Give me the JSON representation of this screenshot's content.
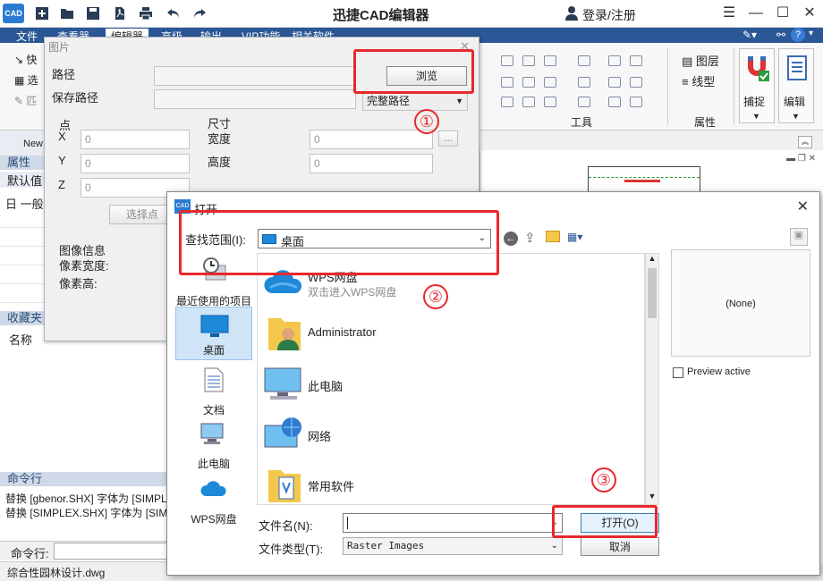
{
  "app": {
    "title": "迅捷CAD编辑器",
    "login": "登录/注册",
    "logo": "CAD"
  },
  "menu": {
    "tabs": [
      "文件",
      "查看器",
      "编辑器",
      "高级",
      "输出",
      "VIP功能",
      "相关软件"
    ]
  },
  "ribbon": {
    "left_labels": [
      "快",
      "选",
      "匹"
    ],
    "groups": {
      "tools": "工具",
      "properties": "属性"
    },
    "layers": "图层",
    "linetype": "线型",
    "capture": "捕捉",
    "edit": "编辑"
  },
  "left_panel": {
    "new_tab": "New",
    "properties_header": "属性",
    "default_values": "默认值",
    "general": "日 一般",
    "favorites_header": "收藏夹",
    "name_col": "名称",
    "cmd_header": "命令行",
    "cmd_lines": [
      "替换 [gbenor.SHX] 字体为 [SIMPL",
      "替换 [SIMPLEX.SHX] 字体为 [SIMP"
    ],
    "cmd_prompt": "命令行:"
  },
  "status": {
    "file": "综合性园林设计.dwg"
  },
  "pic_dialog": {
    "title": "图片",
    "path_label": "路径",
    "save_path_label": "保存路径",
    "browse_button": "浏览",
    "full_path_option": "完整路径",
    "point_label": "点",
    "x_label": "X",
    "y_label": "Y",
    "z_label": "Z",
    "x_value": "0",
    "y_value": "0",
    "z_value": "0",
    "select_point_button": "选择点",
    "size_label": "尺寸",
    "width_label": "宽度",
    "height_label": "高度",
    "width_value": "0",
    "height_value": "0",
    "ellipsis_button": "...",
    "image_info": "图像信息",
    "pixel_width": "像素宽度:",
    "pixel_height": "像素高:"
  },
  "open_dialog": {
    "title": "打开",
    "look_in_label": "查找范围(I):",
    "look_in_value": "桌面",
    "places": [
      "最近使用的项目",
      "桌面",
      "文档",
      "此电脑",
      "WPS网盘"
    ],
    "files": [
      {
        "name": "WPS网盘",
        "sub": "双击进入WPS网盘",
        "icon": "cloud-icon"
      },
      {
        "name": "Administrator",
        "sub": "",
        "icon": "user-folder-icon"
      },
      {
        "name": "此电脑",
        "sub": "",
        "icon": "computer-icon"
      },
      {
        "name": "网络",
        "sub": "",
        "icon": "network-icon"
      },
      {
        "name": "常用软件",
        "sub": "",
        "icon": "folder-icon"
      }
    ],
    "preview_none": "(None)",
    "preview_active": "Preview active",
    "filename_label": "文件名(N):",
    "filename_value": "",
    "filetype_label": "文件类型(T):",
    "filetype_value": "Raster Images",
    "open_button": "打开(O)",
    "cancel_button": "取消"
  },
  "annotations": {
    "one": "①",
    "two": "②",
    "three": "③"
  },
  "colors": {
    "accent": "#2b5797",
    "highlight": "#e8282b",
    "selection": "#cfe4f7"
  }
}
